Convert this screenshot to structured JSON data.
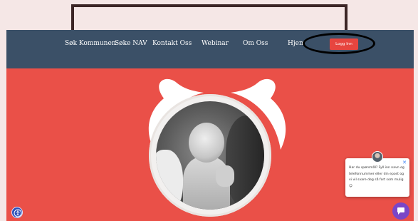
{
  "nav": {
    "items": [
      {
        "label": "Søk Kommunen"
      },
      {
        "label": "Søke NAV"
      },
      {
        "label": "Kontakt Oss"
      },
      {
        "label": "Webinar"
      },
      {
        "label": "Om Oss"
      },
      {
        "label": "Hjem"
      }
    ],
    "login_label": "Logg Inn"
  },
  "chat": {
    "message": "Har du spørsmål? Fyll inn navn og telefonnummer eller din epost og vi vil svare deg så fort som mulig ☺"
  },
  "colors": {
    "nav_bg": "#3b5067",
    "hero_bg": "#ea5048",
    "login_btn": "#e7453f",
    "chat_launcher": "#7a46c7"
  },
  "icons": {
    "accessibility": "accessibility-icon",
    "chat": "chat-bubble-icon",
    "close": "close-icon"
  }
}
